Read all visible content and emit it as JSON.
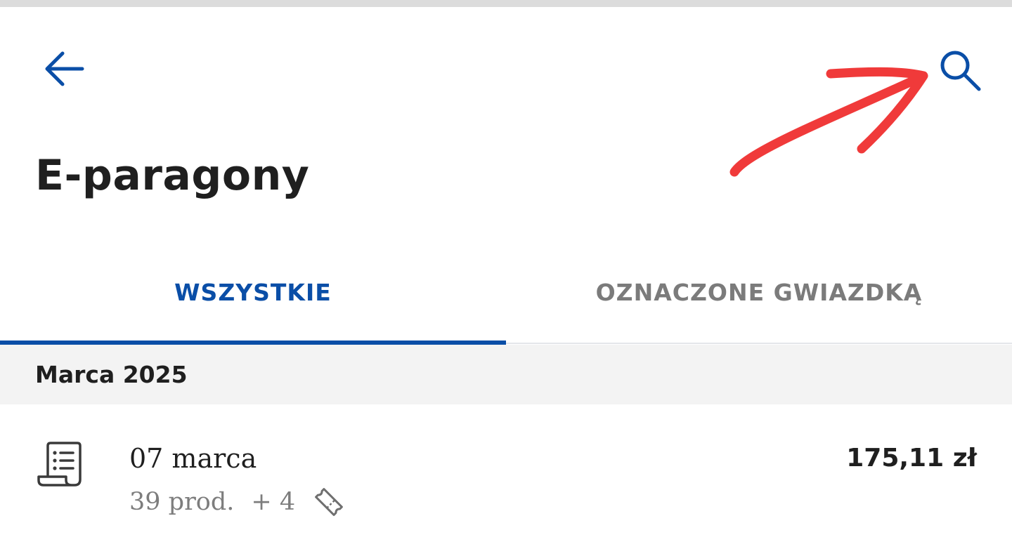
{
  "header": {
    "back_icon": "arrow-left-icon",
    "search_icon": "search-icon",
    "title": "E-paragony"
  },
  "tabs": [
    {
      "label": "WSZYSTKIE",
      "active": true
    },
    {
      "label": "OZNACZONE GWIAZDKĄ",
      "active": false
    }
  ],
  "section": {
    "title": "Marca 2025"
  },
  "receipts": [
    {
      "date": "07 marca",
      "products": "39 prod.",
      "extra": "+ 4",
      "extra_icon": "coupon-tag-icon",
      "amount": "175,11 zł",
      "icon": "receipt-icon"
    }
  ],
  "colors": {
    "accent": "#0a4ea7",
    "text": "#1f1f1f",
    "muted": "#7d7d7d",
    "section_bg": "#f3f3f3",
    "annotation": "#f03a3a"
  }
}
